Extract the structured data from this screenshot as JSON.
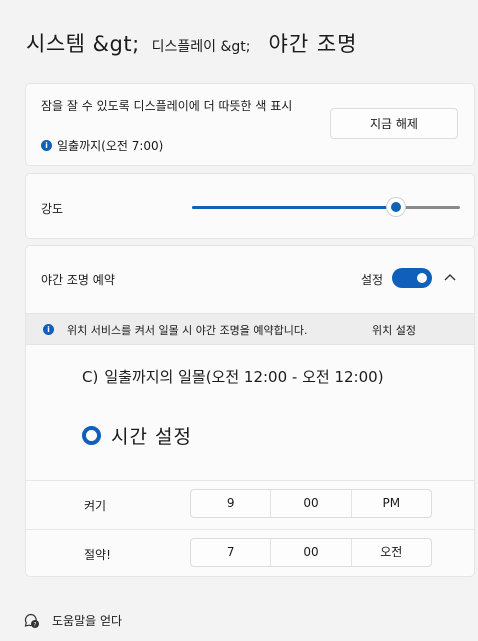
{
  "breadcrumb": {
    "system": "시스템 &gt;",
    "display": "디스플레이 &gt;",
    "current": "야간 조명"
  },
  "now_card": {
    "title": "잠을 잘 수 있도록 디스플레이에 더 따뜻한 색 표시",
    "info": "일출까지(오전 7:00)",
    "button": "지금 해제"
  },
  "strength": {
    "label": "강도",
    "value_percent": 76
  },
  "schedule": {
    "label": "야간 조명 예약",
    "toggle_label": "설정",
    "toggle_on": true,
    "info_text": "위치 서비스를 켜서 일몰 시 야간 조명을 예약합니다.",
    "info_link": "위치 설정",
    "option_sunset_mark": "C)",
    "option_sunset": "일출까지의 일몰(오전 12:00 - 오전 12:00)",
    "option_custom": "시간 설정",
    "on": {
      "label": "켜기",
      "hour": "9",
      "minute": "00",
      "ampm": "PM"
    },
    "off": {
      "label": "절약!",
      "hour": "7",
      "minute": "00",
      "ampm": "오전"
    }
  },
  "help": {
    "label": "도움말을 얻다"
  },
  "colors": {
    "accent": "#0f5fbb",
    "background": "#f3f3f3",
    "card": "#fbfbfb"
  }
}
